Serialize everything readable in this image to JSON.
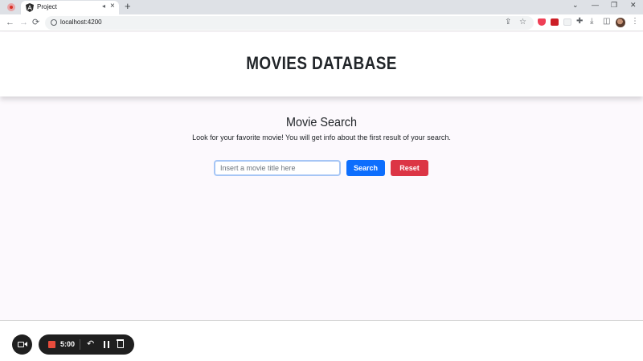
{
  "browser": {
    "tab_title": "Project",
    "tab_close": "×",
    "tab_audio": "◂",
    "new_tab": "+",
    "url": "localhost:4200",
    "window_controls": {
      "minimize": "—",
      "restore": "❐",
      "close": "✕",
      "tab_search": "⌄"
    },
    "nav": {
      "back": "←",
      "forward": "→",
      "reload": "⟳"
    },
    "toolbar_icons": {
      "share": "⇪",
      "star": "☆",
      "extensions": "✚",
      "download": "⤓",
      "sidepanel": "◫",
      "menu": "⋮"
    }
  },
  "header": {
    "title": "MOVIES DATABASE"
  },
  "search_section": {
    "title": "Movie Search",
    "subtitle": "Look for your favorite movie! You will get info about the first result of your search.",
    "input_placeholder": "Insert a movie title here",
    "input_value": "",
    "search_label": "Search",
    "reset_label": "Reset"
  },
  "recorder": {
    "timer": "5:00",
    "undo": "↶"
  },
  "colors": {
    "primary": "#0d6efd",
    "danger": "#dc3545",
    "page_background": "#fcf9fd",
    "recorder_background": "#1f1f1f"
  }
}
